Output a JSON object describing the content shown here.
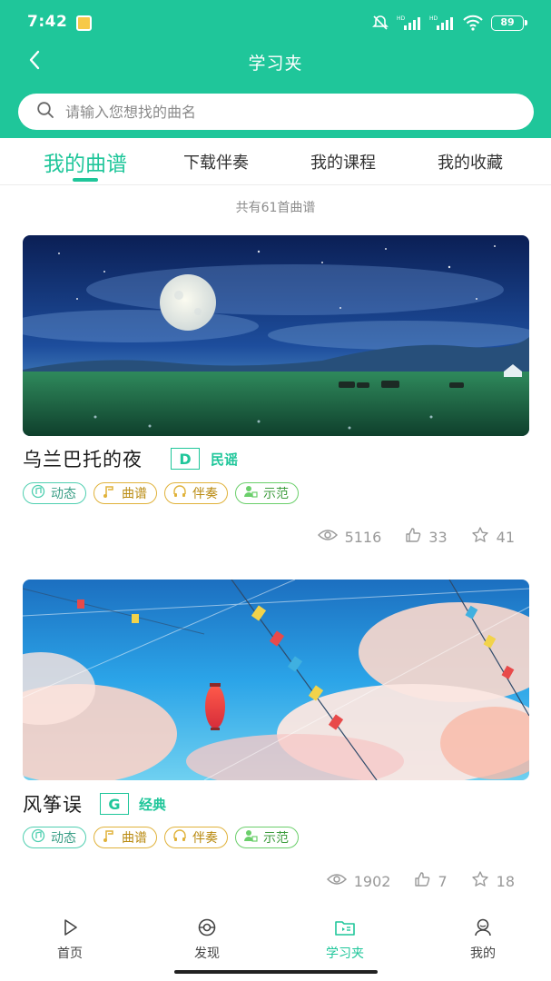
{
  "status_bar": {
    "time": "7:42",
    "battery": "89"
  },
  "nav": {
    "title": "学习夹"
  },
  "search": {
    "placeholder": "请输入您想找的曲名"
  },
  "tabs": [
    {
      "label": "我的曲谱",
      "active": true
    },
    {
      "label": "下载伴奏",
      "active": false
    },
    {
      "label": "我的课程",
      "active": false
    },
    {
      "label": "我的收藏",
      "active": false
    }
  ],
  "summary": {
    "count_text": "共有61首曲谱"
  },
  "songs": [
    {
      "title": "乌兰巴托的夜",
      "key": "D",
      "genre": "民谣",
      "tags": [
        "动态",
        "曲谱",
        "伴奏",
        "示范"
      ],
      "views": "5116",
      "likes": "33",
      "favorites": "41"
    },
    {
      "title": "风筝误",
      "key": "G",
      "genre": "经典",
      "tags": [
        "动态",
        "曲谱",
        "伴奏",
        "示范"
      ],
      "views": "1902",
      "likes": "7",
      "favorites": "18"
    }
  ],
  "bottom_nav": [
    {
      "label": "首页",
      "icon": "play-icon",
      "active": false
    },
    {
      "label": "发现",
      "icon": "discover-icon",
      "active": false
    },
    {
      "label": "学习夹",
      "icon": "folder-icon",
      "active": true
    },
    {
      "label": "我的",
      "icon": "profile-icon",
      "active": false
    }
  ],
  "colors": {
    "accent": "#1fc69a",
    "text": "#222222",
    "muted": "#999999"
  }
}
